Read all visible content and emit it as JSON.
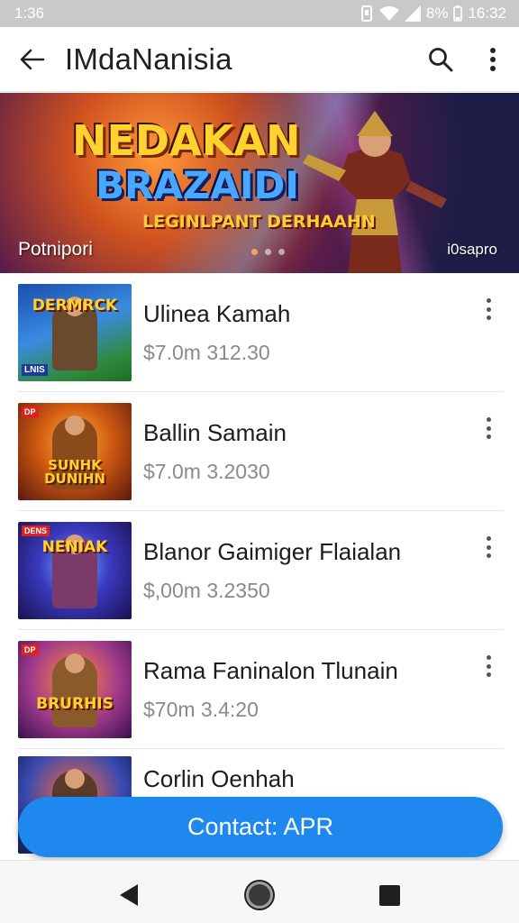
{
  "status_bar": {
    "time": "1:36",
    "battery": "8%",
    "clock": "16:32"
  },
  "app_bar": {
    "title": "IMdaNanisia",
    "back_icon": "arrow-left-icon",
    "search_icon": "search-icon",
    "menu_icon": "more-vertical-icon"
  },
  "banner": {
    "title_line1": "NEDAKAN",
    "title_line2": "BRAZAIDI",
    "subtitle": "LEGINLPANT DERHAAHN",
    "caption": "Potnipori",
    "counter": "i0sapro",
    "dots": 3,
    "active_dot": 1
  },
  "list": {
    "items": [
      {
        "name": "Ulinea Kamah",
        "price": "$7.0m 312.30",
        "thumb_label": "DERMRCK",
        "thumb_tag": "",
        "thumb_corner": "LNIS"
      },
      {
        "name": "Ballin Samain",
        "price": "$7.0m 3.2030",
        "thumb_label": "SUNHK DUNIHN",
        "thumb_tag": "DP",
        "thumb_corner": ""
      },
      {
        "name": "Blanor Gaimiger Flaialan",
        "price": "$,00m 3.2350",
        "thumb_label": "NENIAK",
        "thumb_tag": "DENS",
        "thumb_corner": ""
      },
      {
        "name": "Rama Faninalon Tlunain",
        "price": "$70m 3.4:20",
        "thumb_label": "BRURHIS",
        "thumb_tag": "DP",
        "thumb_corner": ""
      },
      {
        "name": "Corlin Oenhah",
        "price": "",
        "thumb_label": "",
        "thumb_tag": "",
        "thumb_corner": ""
      }
    ]
  },
  "fab": {
    "label": "Contact: APR"
  },
  "nav_bar": {
    "back_icon": "triangle-back-icon",
    "home_icon": "circle-home-icon",
    "recents_icon": "square-recents-icon"
  },
  "colors": {
    "accent": "#1e88ee",
    "status_bar": "#c9c9c9",
    "price_text": "#8a8a8a"
  }
}
